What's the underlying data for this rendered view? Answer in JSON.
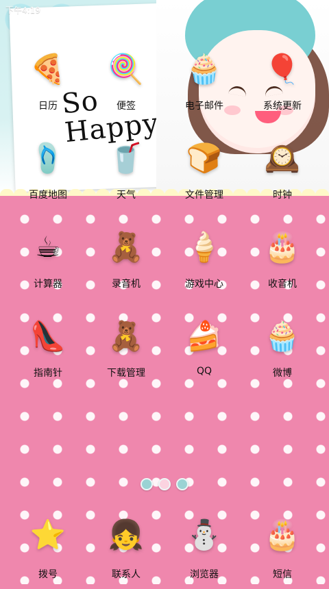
{
  "status_bar": {
    "time_text": "下午4:19"
  },
  "wallpaper": {
    "sticker_text": "So\nHappy"
  },
  "home": {
    "apps": [
      {
        "label": "日历",
        "icon": "pizza-icon",
        "glyph": "🍕"
      },
      {
        "label": "便签",
        "icon": "lollipop-icon",
        "glyph": "🍭"
      },
      {
        "label": "电子邮件",
        "icon": "cupcake-icon",
        "glyph": "🧁"
      },
      {
        "label": "系统更新",
        "icon": "balloons-icon",
        "glyph": "🎈"
      },
      {
        "label": "百度地图",
        "icon": "flip-flops-icon",
        "glyph": "🩴"
      },
      {
        "label": "天气",
        "icon": "iced-drink-icon",
        "glyph": "🥤"
      },
      {
        "label": "文件管理",
        "icon": "toast-icon",
        "glyph": "🍞"
      },
      {
        "label": "时钟",
        "icon": "clock-icon",
        "glyph": "🕰️"
      },
      {
        "label": "计算器",
        "icon": "tea-cup-icon",
        "glyph": "☕"
      },
      {
        "label": "录音机",
        "icon": "teddy-bear-icon",
        "glyph": "🧸"
      },
      {
        "label": "游戏中心",
        "icon": "ice-cream-cone-icon",
        "glyph": "🍦"
      },
      {
        "label": "收音机",
        "icon": "cake-icon",
        "glyph": "🎂"
      },
      {
        "label": "指南针",
        "icon": "high-heel-icon",
        "glyph": "👠"
      },
      {
        "label": "下载管理",
        "icon": "teddy-bear-icon",
        "glyph": "🧸"
      },
      {
        "label": "QQ",
        "icon": "strawberry-cake-slice-icon",
        "glyph": "🍰"
      },
      {
        "label": "微博",
        "icon": "cupcake-icon",
        "glyph": "🧁"
      }
    ],
    "page_indicator": {
      "count": 3,
      "active_index": 1
    }
  },
  "dock": {
    "apps": [
      {
        "label": "拨号",
        "icon": "star-icon",
        "glyph": "⭐"
      },
      {
        "label": "联系人",
        "icon": "doll-face-icon",
        "glyph": "👧"
      },
      {
        "label": "浏览器",
        "icon": "snowman-icon",
        "glyph": "⛄"
      },
      {
        "label": "短信",
        "icon": "cake-icon",
        "glyph": "🎂"
      }
    ]
  }
}
